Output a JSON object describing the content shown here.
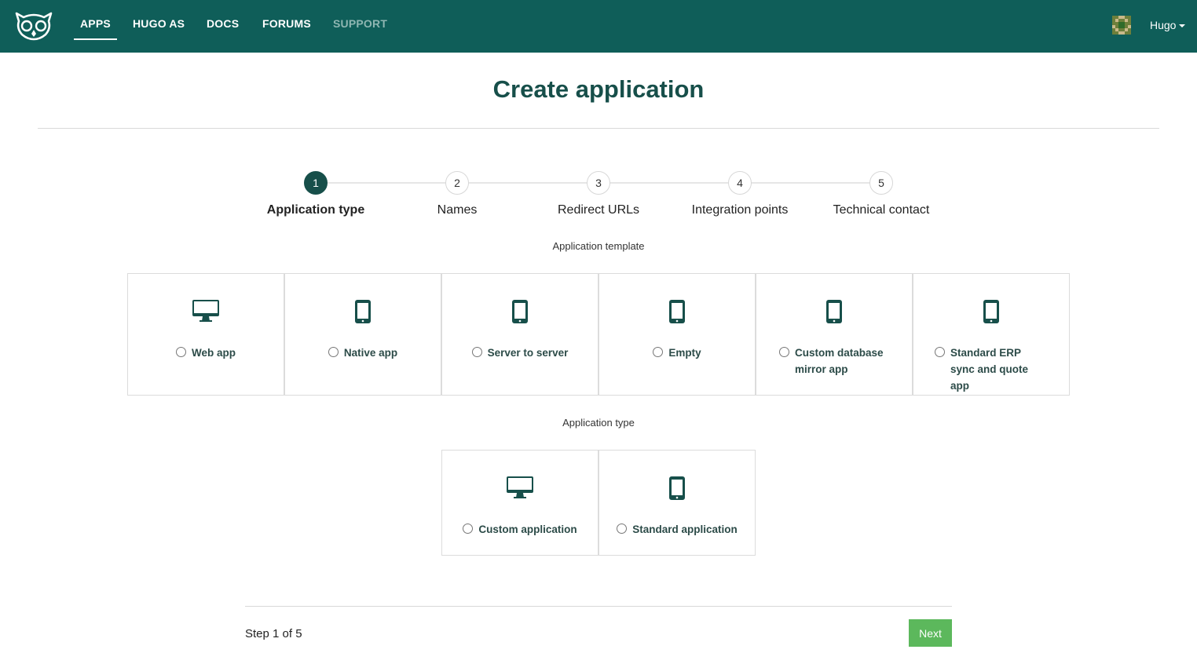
{
  "navbar": {
    "logo_icon": "owl-logo-icon",
    "items": [
      {
        "label": "APPS",
        "active": true
      },
      {
        "label": "HUGO AS",
        "active": false
      },
      {
        "label": "DOCS",
        "active": false
      },
      {
        "label": "FORUMS",
        "active": false
      },
      {
        "label": "SUPPORT",
        "muted": true
      }
    ],
    "user": {
      "name": "Hugo",
      "avatar_icon": "avatar-icon"
    }
  },
  "page_title": "Create application",
  "stepper": {
    "current": 1,
    "steps": [
      {
        "number": "1",
        "label": "Application type"
      },
      {
        "number": "2",
        "label": "Names"
      },
      {
        "number": "3",
        "label": "Redirect URLs"
      },
      {
        "number": "4",
        "label": "Integration points"
      },
      {
        "number": "5",
        "label": "Technical contact"
      }
    ]
  },
  "template_section": {
    "label": "Application template",
    "options": [
      {
        "label": "Web app",
        "icon": "desktop-icon",
        "selected": false
      },
      {
        "label": "Native app",
        "icon": "mobile-icon",
        "selected": false
      },
      {
        "label": "Server to server",
        "icon": "mobile-icon",
        "selected": false
      },
      {
        "label": "Empty",
        "icon": "mobile-icon",
        "selected": false
      },
      {
        "label": "Custom database mirror app",
        "icon": "mobile-icon",
        "selected": false
      },
      {
        "label": "Standard ERP sync and quote app",
        "icon": "mobile-icon",
        "selected": false
      }
    ]
  },
  "type_section": {
    "label": "Application type",
    "options": [
      {
        "label": "Custom application",
        "icon": "desktop-icon",
        "selected": false
      },
      {
        "label": "Standard application",
        "icon": "mobile-icon",
        "selected": false
      }
    ]
  },
  "footer": {
    "step_text": "Step 1 of 5",
    "next_label": "Next"
  },
  "colors": {
    "navbar_bg": "#0f5e59",
    "title": "#174f4a",
    "accent": "#174f4a",
    "next_button": "#5cb85c"
  }
}
